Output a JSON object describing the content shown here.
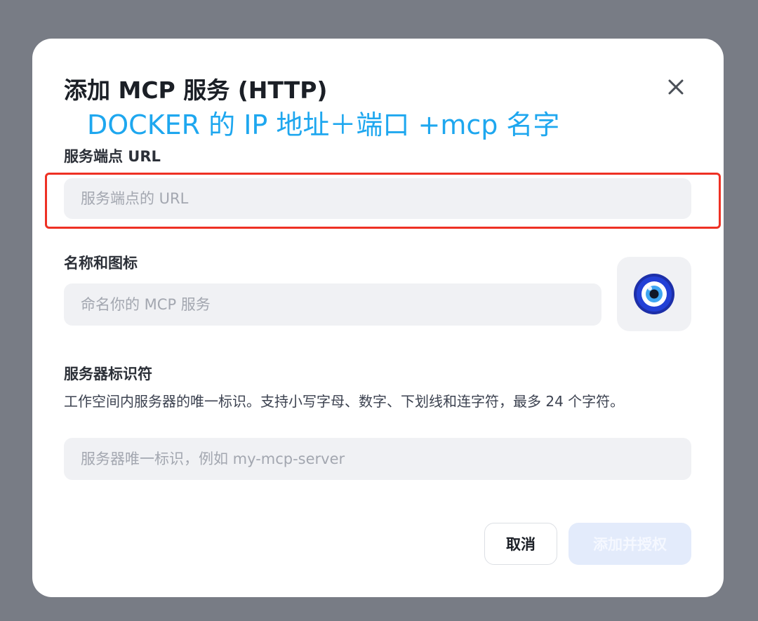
{
  "dialog": {
    "title": "添加 MCP 服务 (HTTP)",
    "annotation": "DOCKER 的 IP 地址＋端口 +mcp 名字"
  },
  "endpoint": {
    "label": "服务端点 URL",
    "placeholder": "服务端点的 URL",
    "value": ""
  },
  "name_icon": {
    "label": "名称和图标",
    "placeholder": "命名你的 MCP 服务",
    "value": "",
    "icon": "nazar-eye-icon"
  },
  "identifier": {
    "label": "服务器标识符",
    "description": "工作空间内服务器的唯一标识。支持小写字母、数字、下划线和连字符，最多 24 个字符。",
    "placeholder": "服务器唯一标识，例如 my-mcp-server",
    "value": ""
  },
  "actions": {
    "cancel_label": "取消",
    "submit_label": "添加并授权"
  },
  "colors": {
    "backdrop": "#787c85",
    "annotation": "#1ea7ef",
    "highlight_border": "#ee3124",
    "submit_disabled_bg": "#e3ebfb"
  }
}
